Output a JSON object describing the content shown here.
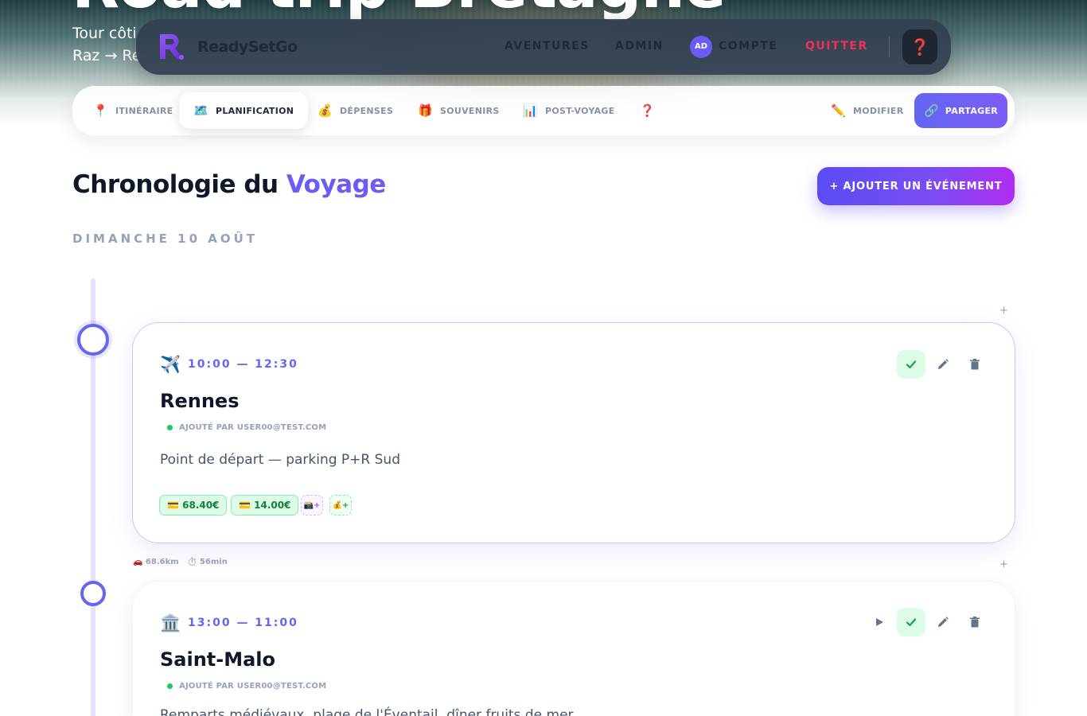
{
  "hero": {
    "title": "Road trip Bretagne",
    "subtitle_line1": "Tour côti",
    "subtitle_line2": "Raz → Re"
  },
  "navbar": {
    "brand": "ReadySetGo",
    "links": {
      "aventures": "AVENTURES",
      "admin": "ADMIN",
      "avatar_initials": "AD",
      "compte": "COMPTE",
      "quitter": "QUITTER"
    },
    "help_icon": "question-mark"
  },
  "tabs": {
    "items": [
      {
        "icon": "📍",
        "label": "ITINÉRAIRE"
      },
      {
        "icon": "🗺️",
        "label": "PLANIFICATION",
        "active": true
      },
      {
        "icon": "💰",
        "label": "DÉPENSES"
      },
      {
        "icon": "🎁",
        "label": "SOUVENIRS"
      },
      {
        "icon": "📊",
        "label": "POST-VOYAGE"
      },
      {
        "icon": "❓",
        "label": ""
      }
    ],
    "edit": {
      "icon": "✏️",
      "label": "MODIFIER"
    },
    "share": {
      "icon": "🔗",
      "label": "PARTAGER"
    }
  },
  "section": {
    "title_main": "Chronologie du",
    "title_accent": "Voyage",
    "add_button": "+ AJOUTER UN ÉVÉNEMENT",
    "date": "DIMANCHE 10 AOÛT"
  },
  "timeline": {
    "add_symbol": "+",
    "events": [
      {
        "icon": "✈️",
        "time": "10:00 — 12:30",
        "title": "Rennes",
        "added_by": "AJOUTÉ PAR USER00@TEST.COM",
        "description": "Point de départ — parking P+R Sud",
        "expenses": [
          "💳 68.40€",
          "💳 14.00€"
        ],
        "add_photo": "📸+",
        "add_expense": "💰+"
      },
      {
        "icon": "🏛️",
        "time": "13:00 — 11:00",
        "title": "Saint-Malo",
        "added_by": "AJOUTÉ PAR USER00@TEST.COM",
        "description": "Remparts médiévaux, plage de l'Éventail, dîner fruits de mer"
      }
    ],
    "travel": {
      "distance": "🚗 68.6km",
      "duration": "⏱️ 56min"
    }
  },
  "colors": {
    "accent": "#6366f1",
    "brand_purple": "#7c3aed",
    "danger": "#f0305a",
    "success": "#22c55e"
  }
}
